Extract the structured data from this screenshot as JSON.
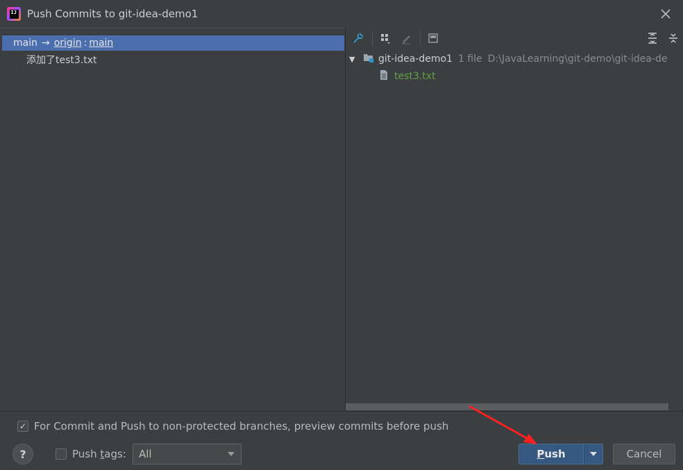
{
  "window": {
    "title": "Push Commits to git-idea-demo1",
    "app_icon_label": "IJ"
  },
  "commits_panel": {
    "branch": {
      "local": "main",
      "arrow": "→",
      "remote": "origin",
      "separator": ":",
      "remote_branch": "main"
    },
    "commits": [
      {
        "message": "添加了test3.txt"
      }
    ]
  },
  "changes_panel": {
    "toolbar": {
      "icons": [
        "pin-icon",
        "group-by-icon",
        "edit-icon",
        "preview-icon",
        "expand-all-icon",
        "collapse-all-icon"
      ]
    },
    "tree": {
      "root_name": "git-idea-demo1",
      "file_count": "1 file",
      "root_path": "D:\\JavaLearning\\git-demo\\git-idea-de",
      "files": [
        {
          "name": "test3.txt"
        }
      ]
    }
  },
  "footer": {
    "preview_checkbox_label": "For Commit and Push to non-protected branches, preview commits before push",
    "preview_checked": true,
    "help_label": "?",
    "push_tags_label_pre": "Push ",
    "push_tags_label_underlined": "t",
    "push_tags_label_post": "ags:",
    "push_tags_checked": false,
    "push_tags_selected": "All",
    "push_label_underlined": "P",
    "push_label_rest": "ush",
    "cancel_label": "Cancel"
  },
  "colors": {
    "selection": "#4b6eaf",
    "file_added": "#62a147",
    "primary_button": "#365880",
    "annotation_arrow": "#ff2020"
  }
}
